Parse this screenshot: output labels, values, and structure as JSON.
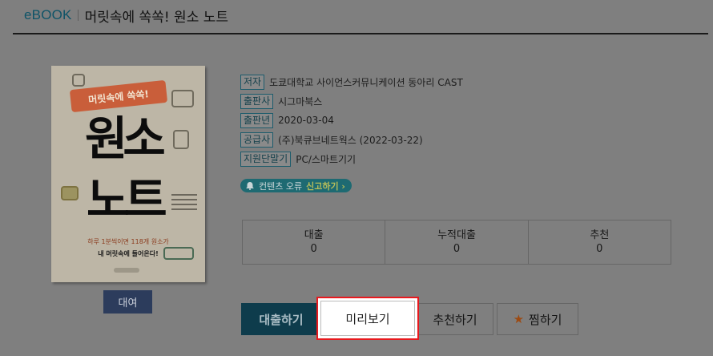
{
  "header": {
    "category": "eBOOK",
    "title": "머릿속에 쏙쏙! 원소 노트"
  },
  "cover": {
    "ribbon": "머릿속에 쏙쏙!",
    "title_line1": "원소",
    "title_line2": "노트",
    "subtitle1": "하루 1분씩이면 118개 원소가",
    "subtitle2": "내 머릿속에 들어온다!"
  },
  "rent_label": "대여",
  "meta": [
    {
      "tag": "저자",
      "value": "도쿄대학교 사이언스커뮤니케이션 동아리 CAST"
    },
    {
      "tag": "출판사",
      "value": "시그마북스"
    },
    {
      "tag": "출판년",
      "value": "2020-03-04"
    },
    {
      "tag": "공급사",
      "value": "(주)북큐브네트웍스 (2022-03-22)"
    },
    {
      "tag": "지원단말기",
      "value": "PC/스마트기기"
    }
  ],
  "report": {
    "label": "컨텐츠 오류",
    "link": "신고하기 ›"
  },
  "stats": [
    {
      "label": "대출",
      "value": "0"
    },
    {
      "label": "누적대출",
      "value": "0"
    },
    {
      "label": "추천",
      "value": "0"
    }
  ],
  "buttons": {
    "loan": "대출하기",
    "preview": "미리보기",
    "recommend": "추천하기",
    "wishlist": "찜하기"
  },
  "icons": {
    "report": "bell-icon",
    "wishlist": "star-icon"
  },
  "colors": {
    "highlight_border": "#e8191e",
    "loan_button": "#0e3c4c",
    "category": "#0f5468"
  }
}
